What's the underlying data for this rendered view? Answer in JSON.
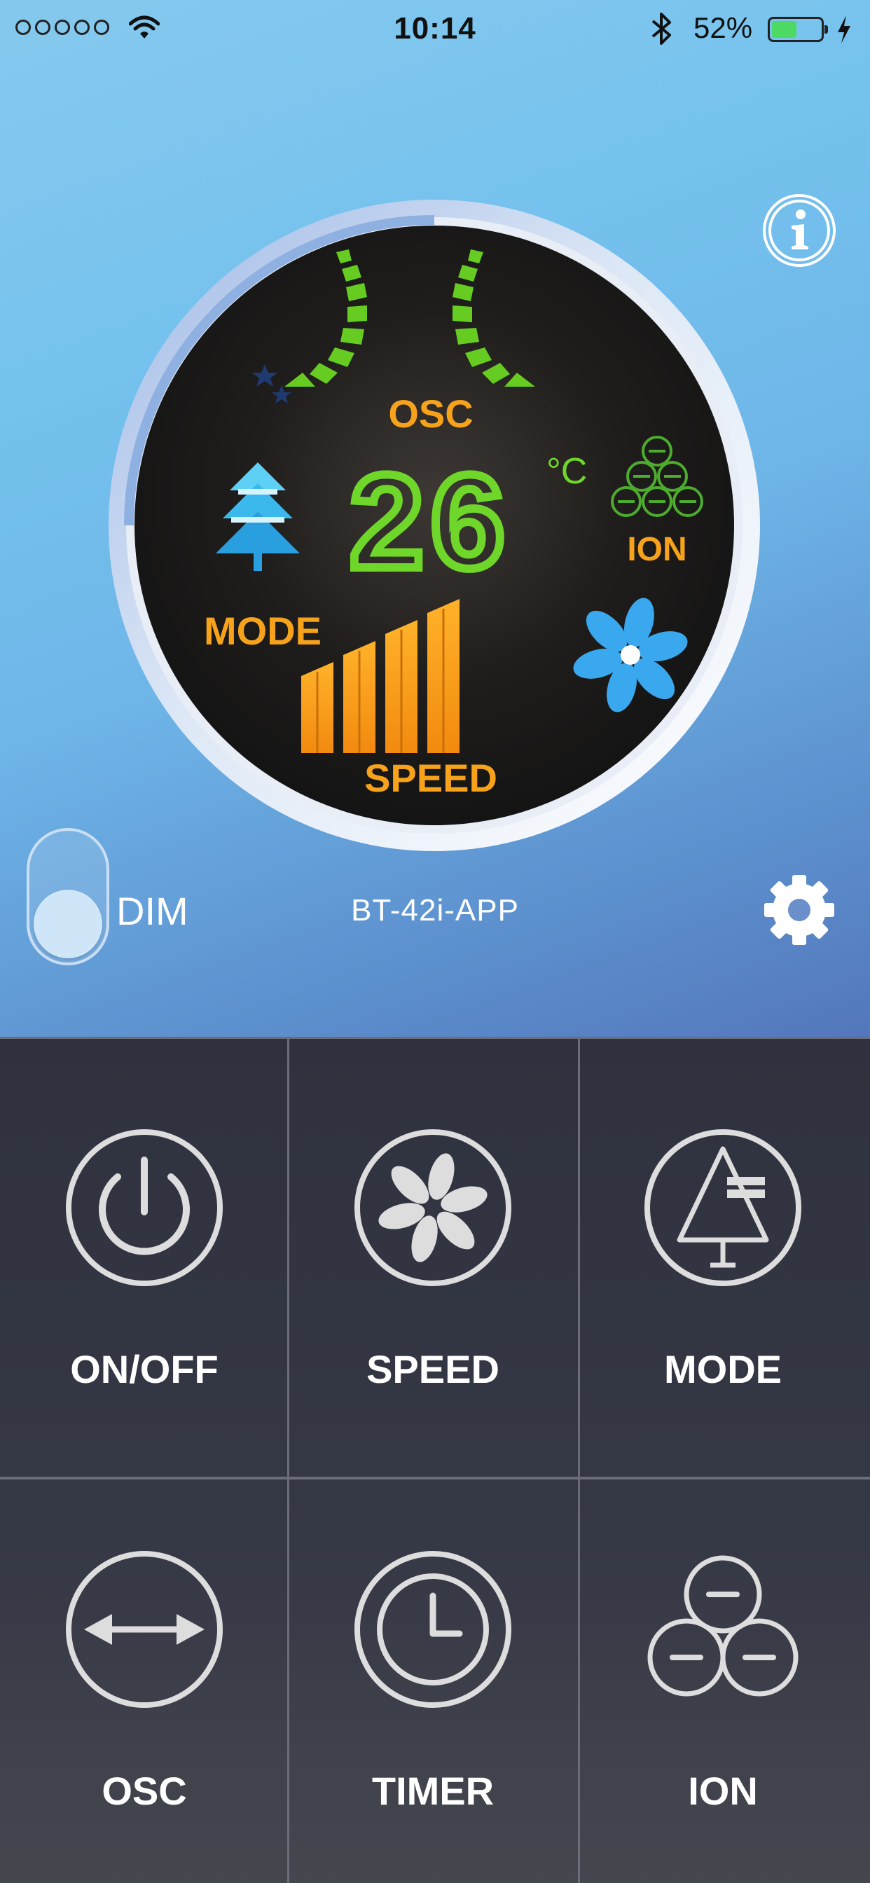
{
  "status_bar": {
    "time": "10:14",
    "battery_percent": "52%",
    "battery_level": 0.52,
    "signal_icon": "signal-dots-icon",
    "wifi_icon": "wifi-icon",
    "bluetooth_icon": "bluetooth-icon",
    "charging_icon": "charging-bolt-icon"
  },
  "display": {
    "osc_label": "OSC",
    "temperature": "26",
    "unit": "°C",
    "ion_label": "ION",
    "mode_label": "MODE",
    "speed_label": "SPEED",
    "speed_level": 4
  },
  "dim": {
    "label": "DIM",
    "enabled": false
  },
  "device_name": "BT-42i-APP",
  "controls": [
    {
      "label": "ON/OFF",
      "icon": "power-icon"
    },
    {
      "label": "SPEED",
      "icon": "fan-icon"
    },
    {
      "label": "MODE",
      "icon": "tree-mode-icon"
    },
    {
      "label": "OSC",
      "icon": "oscillate-arrows-icon"
    },
    {
      "label": "TIMER",
      "icon": "clock-icon"
    },
    {
      "label": "ION",
      "icon": "ion-icon"
    }
  ],
  "colors": {
    "sky_blue": "#75c2ee",
    "display_bg": "#1c1b1a",
    "lcd_green": "#6fd62a",
    "lcd_orange": "#f7a21b",
    "lcd_blue": "#3aa8ee",
    "panel_dark": "#2f323e"
  }
}
